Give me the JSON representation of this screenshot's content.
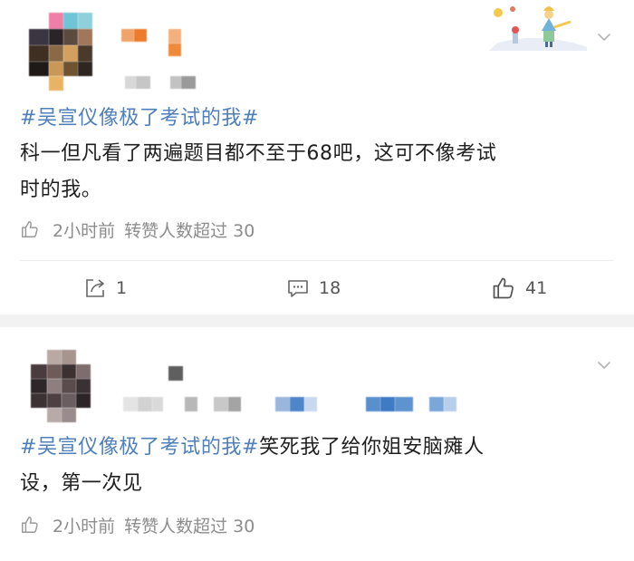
{
  "feed": {
    "posts": [
      {
        "hashtag": "#吴宣仪像极了考试的我#",
        "body_line1": "科一但凡看了两遍题目都不至于68吧，这可不像考试",
        "body_line2": "时的我。",
        "time": "2小时前",
        "repost_note": "转赞人数超过 30",
        "actions": {
          "share_count": "1",
          "comment_count": "18",
          "like_count": "41"
        }
      },
      {
        "hashtag": "#吴宣仪像极了考试的我#",
        "body_line1_rest": "笑死我了给你姐安脑瘫人",
        "body_line2": "设，第一次见",
        "time": "2小时前",
        "repost_note": "转赞人数超过 30"
      }
    ]
  },
  "colors": {
    "hashtag": "#4e7fbb",
    "text": "#1f1f1f",
    "meta": "#8c8c8c",
    "separator": "#f2f2f2"
  },
  "icons": {
    "header_decoration": "little-prince-icon",
    "more": "chevron-down-icon",
    "like": "thumb-up-icon",
    "share": "share-icon",
    "comment": "comment-icon"
  }
}
